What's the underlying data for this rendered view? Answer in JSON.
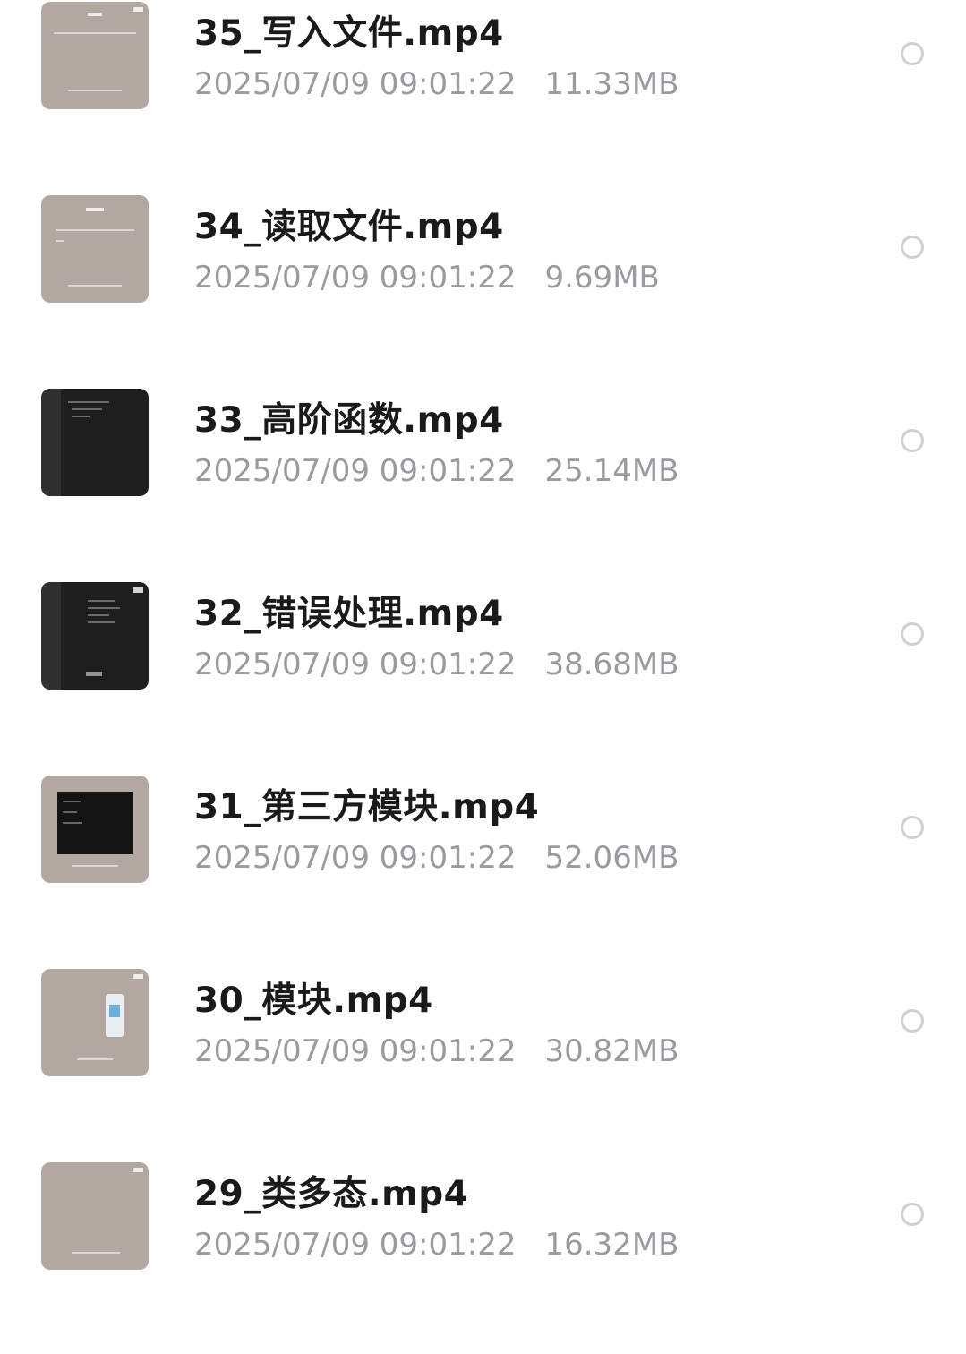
{
  "files": [
    {
      "name": "35_写入文件.mp4",
      "datetime": "2025/07/09 09:01:22",
      "size": "11.33MB",
      "thumb_style": "light-text"
    },
    {
      "name": "34_读取文件.mp4",
      "datetime": "2025/07/09 09:01:22",
      "size": "9.69MB",
      "thumb_style": "light-text"
    },
    {
      "name": "33_高阶函数.mp4",
      "datetime": "2025/07/09 09:01:22",
      "size": "25.14MB",
      "thumb_style": "dark-code"
    },
    {
      "name": "32_错误处理.mp4",
      "datetime": "2025/07/09 09:01:22",
      "size": "38.68MB",
      "thumb_style": "dark-code"
    },
    {
      "name": "31_第三方模块.mp4",
      "datetime": "2025/07/09 09:01:22",
      "size": "52.06MB",
      "thumb_style": "light-screen"
    },
    {
      "name": "30_模块.mp4",
      "datetime": "2025/07/09 09:01:22",
      "size": "30.82MB",
      "thumb_style": "light-phone"
    },
    {
      "name": "29_类多态.mp4",
      "datetime": "2025/07/09 09:01:22",
      "size": "16.32MB",
      "thumb_style": "light-blank"
    }
  ],
  "colors": {
    "title": "#1a1a1a",
    "meta": "#9a9aa1",
    "thumb_light": "#b2a7a1",
    "thumb_dark": "#1e1e1e",
    "radio_border": "#cfcfd3"
  },
  "icons": {
    "select": "radio-unchecked-icon",
    "thumbnail": "video-thumbnail"
  }
}
